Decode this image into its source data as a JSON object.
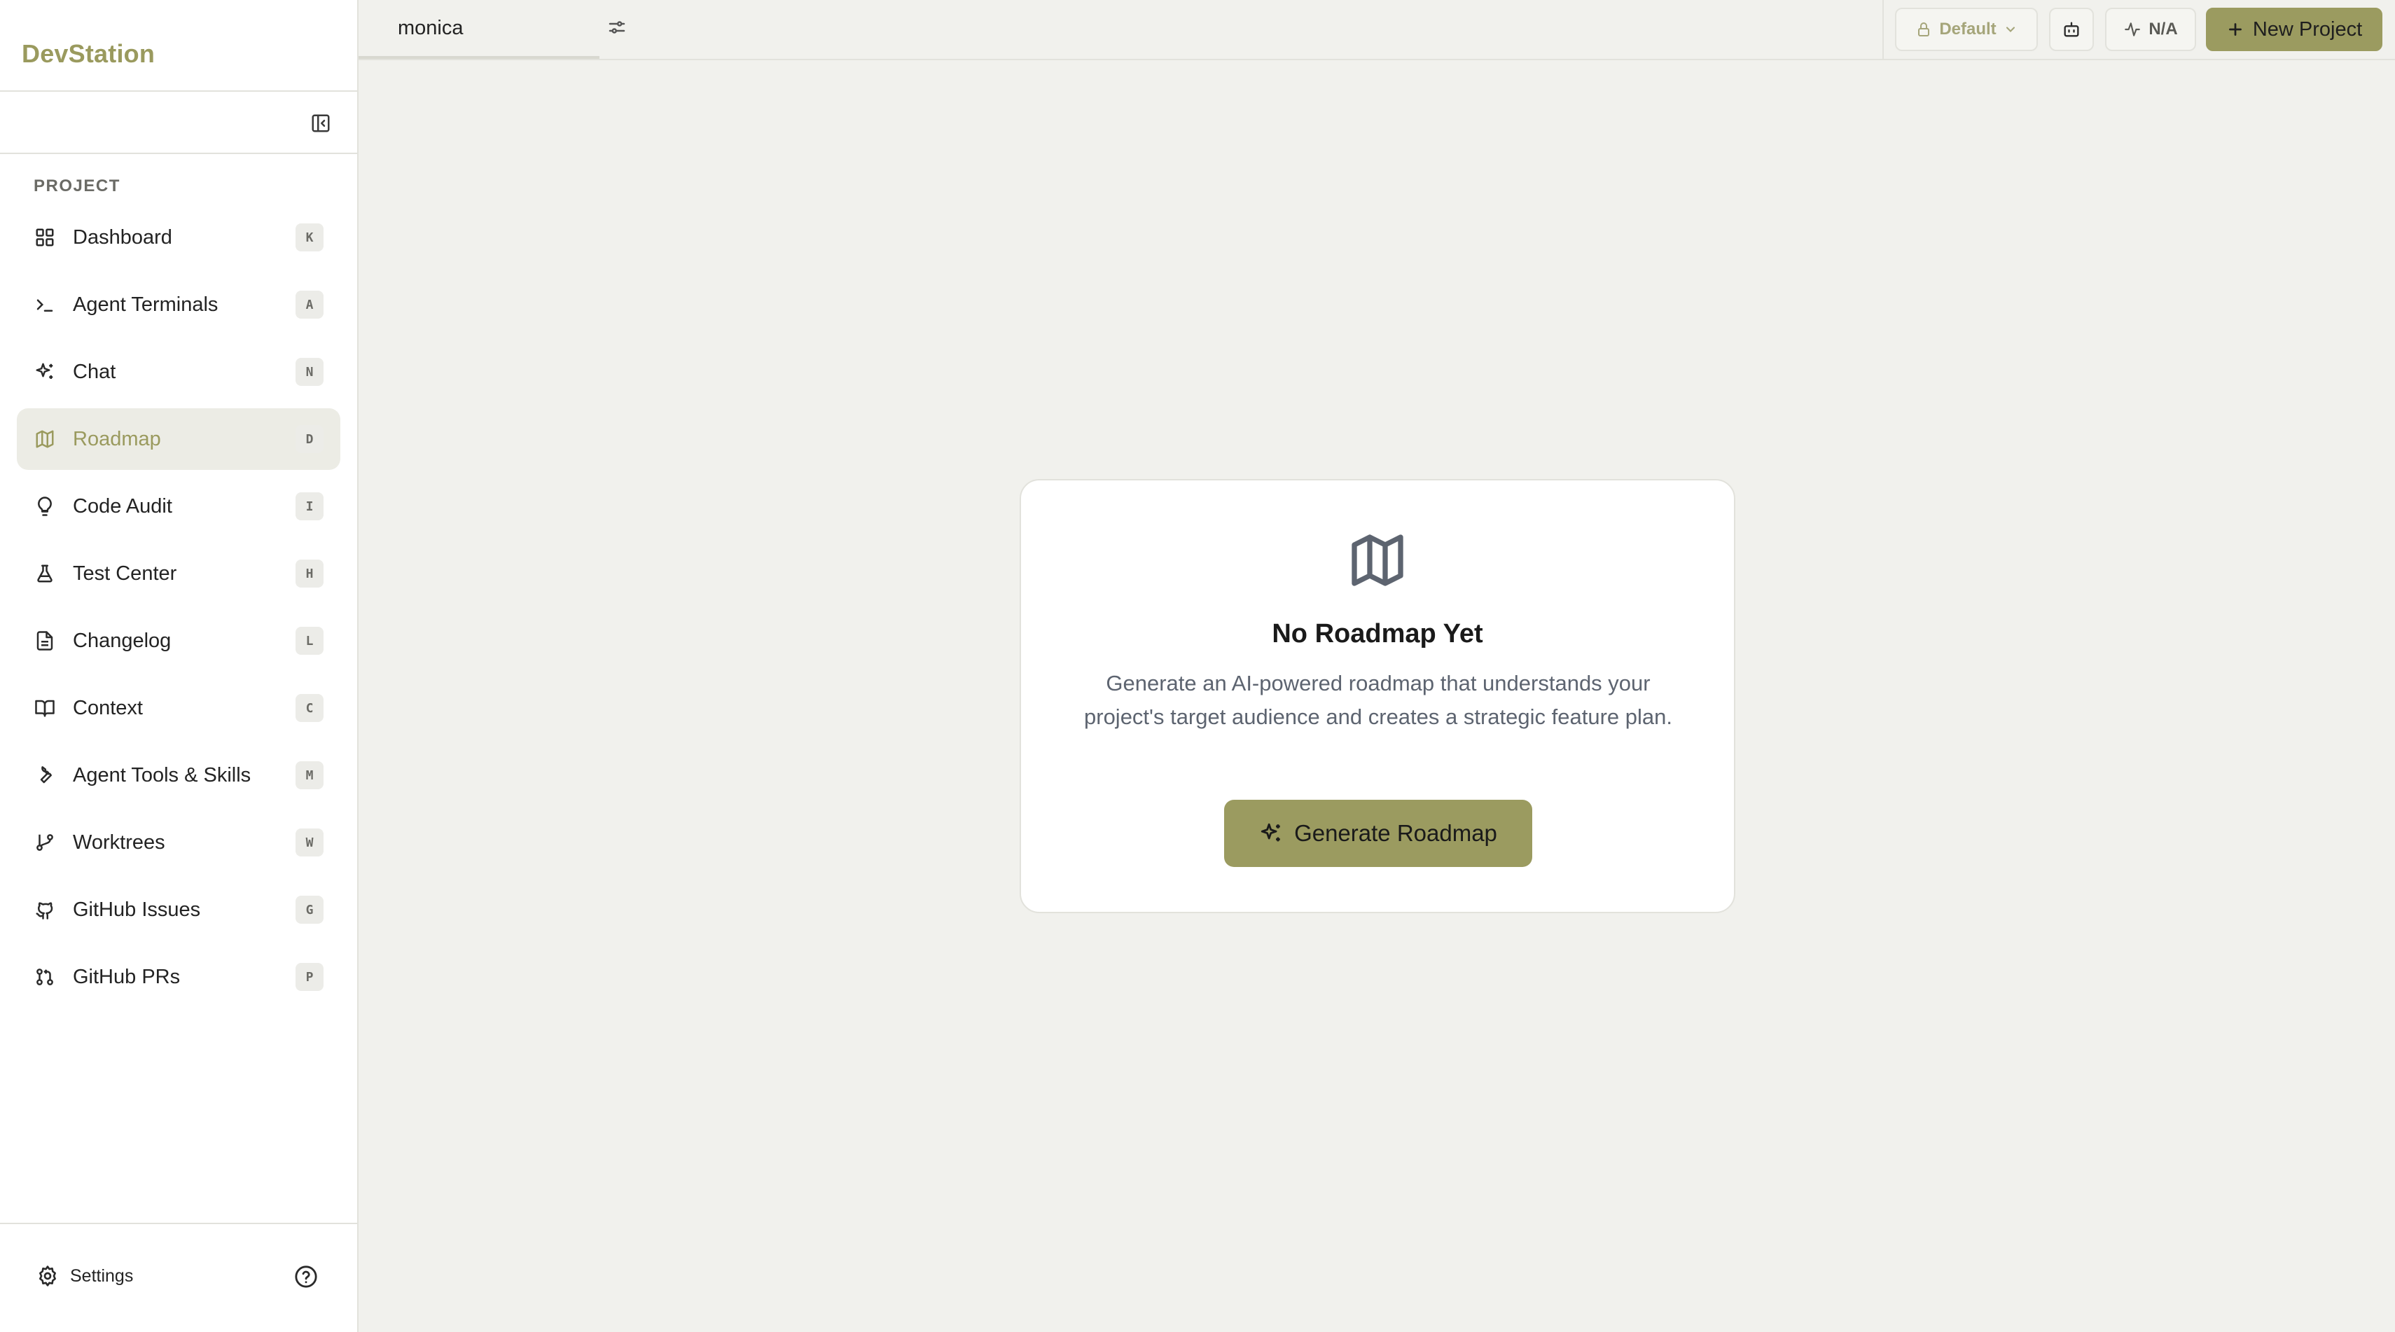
{
  "app": {
    "brand": "DevStation"
  },
  "sidebar": {
    "section_label": "PROJECT",
    "items": [
      {
        "label": "Dashboard",
        "shortcut": "K",
        "icon": "grid-icon"
      },
      {
        "label": "Agent Terminals",
        "shortcut": "A",
        "icon": "terminal-icon"
      },
      {
        "label": "Chat",
        "shortcut": "N",
        "icon": "sparkles-icon"
      },
      {
        "label": "Roadmap",
        "shortcut": "D",
        "icon": "map-icon",
        "active": true
      },
      {
        "label": "Code Audit",
        "shortcut": "I",
        "icon": "lightbulb-icon"
      },
      {
        "label": "Test Center",
        "shortcut": "H",
        "icon": "flask-icon"
      },
      {
        "label": "Changelog",
        "shortcut": "L",
        "icon": "file-text-icon"
      },
      {
        "label": "Context",
        "shortcut": "C",
        "icon": "book-open-icon"
      },
      {
        "label": "Agent Tools & Skills",
        "shortcut": "M",
        "icon": "wrench-icon"
      },
      {
        "label": "Worktrees",
        "shortcut": "W",
        "icon": "git-branch-icon"
      },
      {
        "label": "GitHub Issues",
        "shortcut": "G",
        "icon": "github-icon"
      },
      {
        "label": "GitHub PRs",
        "shortcut": "P",
        "icon": "git-pull-request-icon"
      }
    ],
    "footer": {
      "settings_label": "Settings"
    }
  },
  "topbar": {
    "project_tab": "monica",
    "profile_label": "Default",
    "status_label": "N/A",
    "new_project_label": "New Project"
  },
  "empty_state": {
    "title": "No Roadmap Yet",
    "description": "Generate an AI-powered roadmap that understands your project's target audience and creates a strategic feature plan.",
    "button_label": "Generate Roadmap"
  },
  "colors": {
    "accent": "#9b9b60",
    "brand_text": "#9a9a5e",
    "background": "#f1f1ed",
    "sidebar_bg": "#ffffff",
    "active_item_bg": "#ecece5"
  }
}
